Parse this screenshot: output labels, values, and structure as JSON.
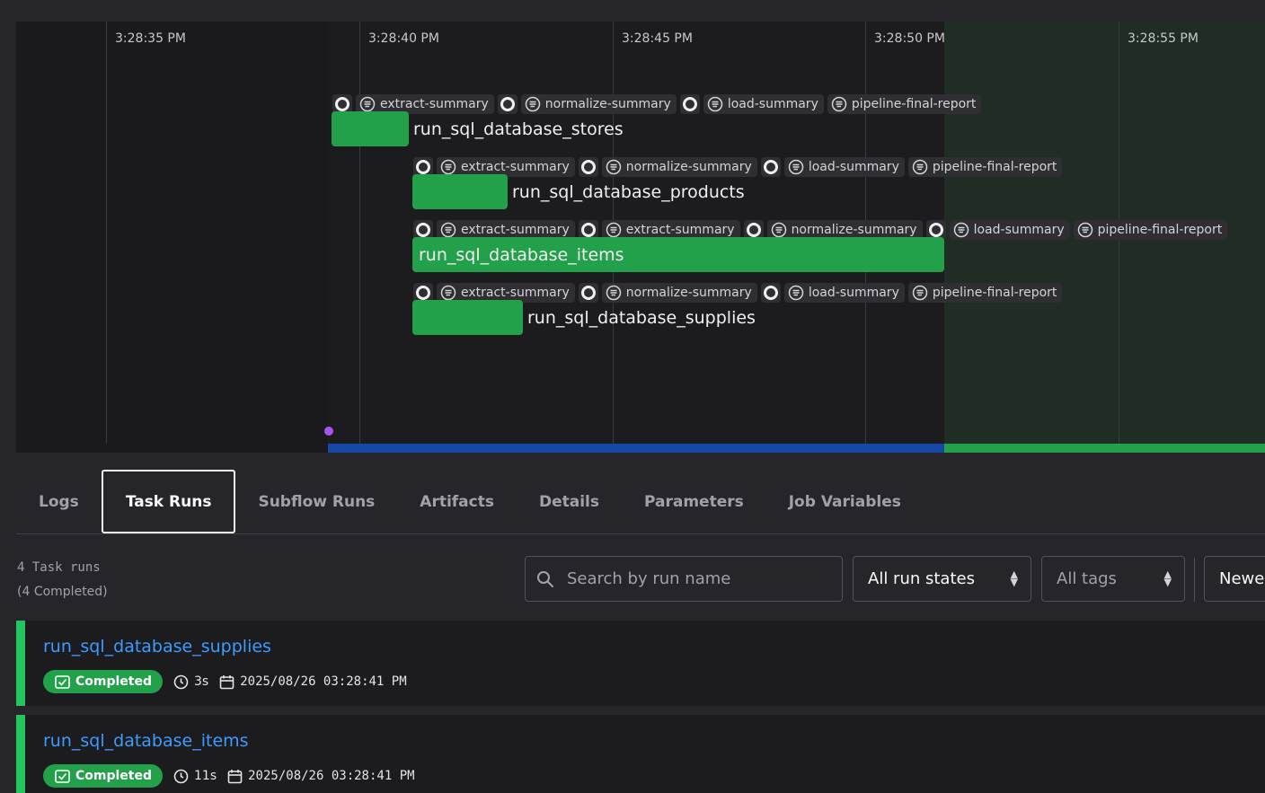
{
  "timeline": {
    "time_labels": [
      "3:28:35 PM",
      "3:28:40 PM",
      "3:28:45 PM",
      "3:28:50 PM",
      "3:28:55 PM"
    ],
    "rows": [
      {
        "name": "run_sql_database_stores",
        "artifacts": [
          "ring",
          "extract-summary",
          "ring",
          "normalize-summary",
          "ring",
          "load-summary",
          "pipeline-final-report"
        ]
      },
      {
        "name": "run_sql_database_products",
        "artifacts": [
          "ring",
          "extract-summary",
          "ring",
          "normalize-summary",
          "ring",
          "load-summary",
          "pipeline-final-report"
        ]
      },
      {
        "name": "run_sql_database_items",
        "artifacts": [
          "ring",
          "extract-summary",
          "ring",
          "extract-summary",
          "ring",
          "normalize-summary",
          "ring",
          "load-summary",
          "pipeline-final-report"
        ]
      },
      {
        "name": "run_sql_database_supplies",
        "artifacts": [
          "ring",
          "extract-summary",
          "ring",
          "normalize-summary",
          "ring",
          "load-summary",
          "pipeline-final-report"
        ]
      }
    ]
  },
  "tabs": [
    "Logs",
    "Task Runs",
    "Subflow Runs",
    "Artifacts",
    "Details",
    "Parameters",
    "Job Variables"
  ],
  "active_tab": "Task Runs",
  "task_runs": {
    "count_label": "4 Task runs",
    "completed_label": "(4 Completed)",
    "search_placeholder": "Search by run name",
    "state_filter": "All run states",
    "tag_filter": "All tags",
    "sort": "Newe",
    "runs": [
      {
        "name": "run_sql_database_supplies",
        "state": "Completed",
        "duration": "3s",
        "start": "2025/08/26 03:28:41 PM"
      },
      {
        "name": "run_sql_database_items",
        "state": "Completed",
        "duration": "11s",
        "start": "2025/08/26 03:28:41 PM"
      }
    ]
  },
  "colors": {
    "completed": "#22a04a",
    "link": "#3b9cff",
    "running_bar": "#1747a6",
    "now_marker": "#a855f7"
  },
  "icons": [
    "artifact-ring-icon",
    "artifact-summary-icon",
    "search-icon",
    "chevron-updown-icon",
    "check-icon",
    "clock-icon",
    "calendar-icon"
  ]
}
